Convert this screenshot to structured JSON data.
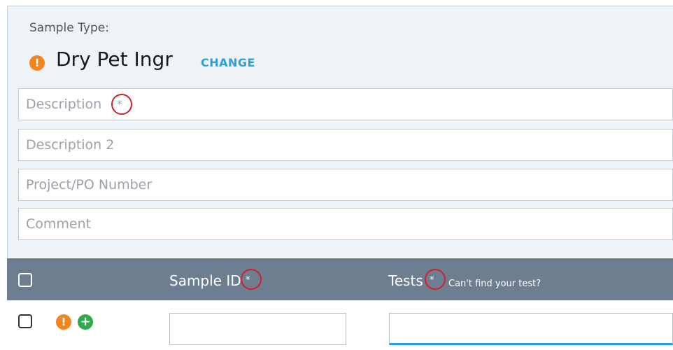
{
  "sample_type": {
    "label": "Sample Type:",
    "value": "Dry Pet Ingr",
    "change_label": "CHANGE"
  },
  "fields": {
    "description": {
      "placeholder": "Description",
      "value": "",
      "required_mark": "*"
    },
    "description2": {
      "placeholder": "Description 2",
      "value": ""
    },
    "project_po": {
      "placeholder": "Project/PO Number",
      "value": ""
    },
    "comment": {
      "placeholder": "Comment",
      "value": ""
    }
  },
  "table": {
    "columns": {
      "sample_id": "Sample ID",
      "sample_id_required": "*",
      "tests": "Tests",
      "tests_required": "*",
      "cant_find": "Can't find your test?"
    },
    "row": {
      "sample_id_value": "",
      "tests_value": ""
    }
  },
  "icons": {
    "warning": "!",
    "add": "+"
  },
  "colors": {
    "accent": "#2a9fd8",
    "warning": "#f5841f",
    "add": "#2ea94b",
    "header_bg": "#6f7d91",
    "panel_bg": "#eef3f8",
    "annotation": "#d0202a"
  }
}
